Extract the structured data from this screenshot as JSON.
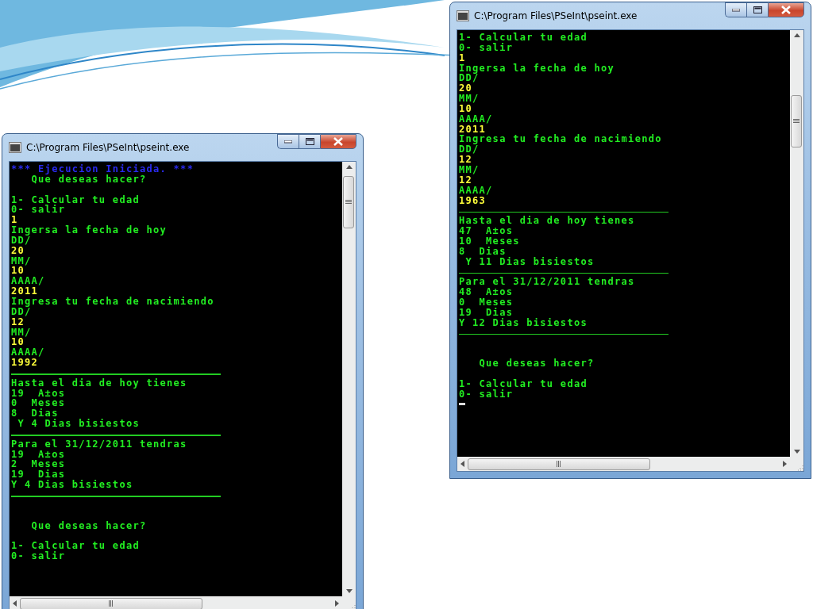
{
  "windows": [
    {
      "title": "C:\\Program Files\\PSeInt\\pseint.exe",
      "lines": [
        {
          "kind": "blue",
          "text": "*** Ejecucion Iniciada. ***"
        },
        {
          "kind": "green",
          "text": "   Que deseas hacer?"
        },
        {
          "kind": "blank"
        },
        {
          "kind": "green",
          "text": "1- Calcular tu edad"
        },
        {
          "kind": "green",
          "text": "0- salir"
        },
        {
          "kind": "yellow",
          "text": "1"
        },
        {
          "kind": "green",
          "text": "Ingersa la fecha de hoy"
        },
        {
          "kind": "green",
          "text": "DD/"
        },
        {
          "kind": "yellow",
          "text": "20"
        },
        {
          "kind": "green",
          "text": "MM/"
        },
        {
          "kind": "yellow",
          "text": "10"
        },
        {
          "kind": "green",
          "text": "AAAA/"
        },
        {
          "kind": "yellow",
          "text": "2011"
        },
        {
          "kind": "green",
          "text": "Ingresa tu fecha de nacimiendo"
        },
        {
          "kind": "green",
          "text": "DD/"
        },
        {
          "kind": "yellow",
          "text": "12"
        },
        {
          "kind": "green",
          "text": "MM/"
        },
        {
          "kind": "yellow",
          "text": "10"
        },
        {
          "kind": "green",
          "text": "AAAA/"
        },
        {
          "kind": "yellow",
          "text": "1992"
        },
        {
          "kind": "rule"
        },
        {
          "kind": "green",
          "text": "Hasta el dia de hoy tienes"
        },
        {
          "kind": "green",
          "text": "19  A±os"
        },
        {
          "kind": "green",
          "text": "0  Meses"
        },
        {
          "kind": "green",
          "text": "8  Dias"
        },
        {
          "kind": "green",
          "text": " Y 4 Dias bisiestos"
        },
        {
          "kind": "rule"
        },
        {
          "kind": "green",
          "text": "Para el 31/12/2011 tendras"
        },
        {
          "kind": "green",
          "text": "19  A±os"
        },
        {
          "kind": "green",
          "text": "2  Meses"
        },
        {
          "kind": "green",
          "text": "19  Dias"
        },
        {
          "kind": "green",
          "text": "Y 4 Dias bisiestos"
        },
        {
          "kind": "rule"
        },
        {
          "kind": "blank"
        },
        {
          "kind": "blank"
        },
        {
          "kind": "green",
          "text": "   Que deseas hacer?"
        },
        {
          "kind": "blank"
        },
        {
          "kind": "green",
          "text": "1- Calcular tu edad"
        },
        {
          "kind": "green",
          "text": "0- salir"
        }
      ]
    },
    {
      "title": "C:\\Program Files\\PSeInt\\pseint.exe",
      "lines": [
        {
          "kind": "green",
          "text": "1- Calcular tu edad"
        },
        {
          "kind": "green",
          "text": "0- salir"
        },
        {
          "kind": "yellow",
          "text": "1"
        },
        {
          "kind": "green",
          "text": "Ingersa la fecha de hoy"
        },
        {
          "kind": "green",
          "text": "DD/"
        },
        {
          "kind": "yellow",
          "text": "20"
        },
        {
          "kind": "green",
          "text": "MM/"
        },
        {
          "kind": "yellow",
          "text": "10"
        },
        {
          "kind": "green",
          "text": "AAAA/"
        },
        {
          "kind": "yellow",
          "text": "2011"
        },
        {
          "kind": "green",
          "text": "Ingresa tu fecha de nacimiendo"
        },
        {
          "kind": "green",
          "text": "DD/"
        },
        {
          "kind": "yellow",
          "text": "12"
        },
        {
          "kind": "green",
          "text": "MM/"
        },
        {
          "kind": "yellow",
          "text": "12"
        },
        {
          "kind": "green",
          "text": "AAAA/"
        },
        {
          "kind": "yellow",
          "text": "1963"
        },
        {
          "kind": "rule"
        },
        {
          "kind": "green",
          "text": "Hasta el dia de hoy tienes"
        },
        {
          "kind": "green",
          "text": "47  A±os"
        },
        {
          "kind": "green",
          "text": "10  Meses"
        },
        {
          "kind": "green",
          "text": "8  Dias"
        },
        {
          "kind": "green",
          "text": " Y 11 Dias bisiestos"
        },
        {
          "kind": "rule"
        },
        {
          "kind": "green",
          "text": "Para el 31/12/2011 tendras"
        },
        {
          "kind": "green",
          "text": "48  A±os"
        },
        {
          "kind": "green",
          "text": "0  Meses"
        },
        {
          "kind": "green",
          "text": "19  Dias"
        },
        {
          "kind": "green",
          "text": "Y 12 Dias bisiestos"
        },
        {
          "kind": "rule"
        },
        {
          "kind": "blank"
        },
        {
          "kind": "blank"
        },
        {
          "kind": "green",
          "text": "   Que deseas hacer?"
        },
        {
          "kind": "blank"
        },
        {
          "kind": "green",
          "text": "1- Calcular tu edad"
        },
        {
          "kind": "green",
          "text": "0- salir"
        },
        {
          "kind": "cursor"
        }
      ]
    }
  ]
}
